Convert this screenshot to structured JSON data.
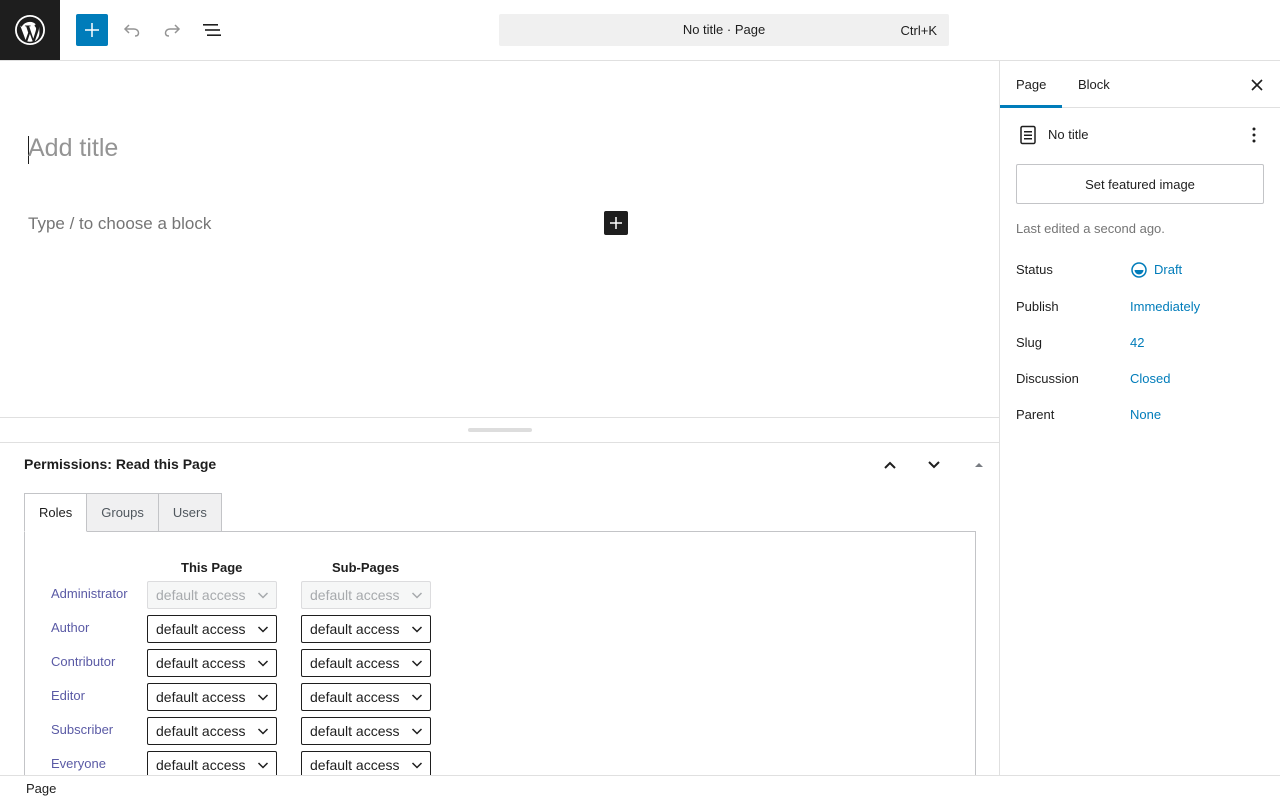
{
  "topbar": {
    "command_title": "No title · Page",
    "command_shortcut": "Ctrl+K"
  },
  "editor": {
    "title_placeholder": "Add title",
    "block_placeholder": "Type / to choose a block"
  },
  "metabox": {
    "title": "Permissions: Read this Page",
    "tabs": [
      "Roles",
      "Groups",
      "Users"
    ],
    "columns": [
      "This Page",
      "Sub-Pages"
    ],
    "rows": [
      {
        "role": "Administrator",
        "this_page": "default access",
        "sub_pages": "default access",
        "disabled": true
      },
      {
        "role": "Author",
        "this_page": "default access",
        "sub_pages": "default access",
        "disabled": false
      },
      {
        "role": "Contributor",
        "this_page": "default access",
        "sub_pages": "default access",
        "disabled": false
      },
      {
        "role": "Editor",
        "this_page": "default access",
        "sub_pages": "default access",
        "disabled": false
      },
      {
        "role": "Subscriber",
        "this_page": "default access",
        "sub_pages": "default access",
        "disabled": false
      },
      {
        "role": "Everyone",
        "this_page": "default access",
        "sub_pages": "default access",
        "disabled": false
      }
    ]
  },
  "statusbar": {
    "breadcrumb": "Page"
  },
  "sidebar": {
    "tabs": [
      "Page",
      "Block"
    ],
    "doc_title": "No title",
    "featured_image_button": "Set featured image",
    "last_edited": "Last edited a second ago.",
    "properties": [
      {
        "key": "Status",
        "value": "Draft"
      },
      {
        "key": "Publish",
        "value": "Immediately"
      },
      {
        "key": "Slug",
        "value": "42"
      },
      {
        "key": "Discussion",
        "value": "Closed"
      },
      {
        "key": "Parent",
        "value": "None"
      }
    ]
  },
  "colors": {
    "accent": "#007cba",
    "logo_bg": "#1e1e1e",
    "role_link": "#5a5aa5"
  }
}
